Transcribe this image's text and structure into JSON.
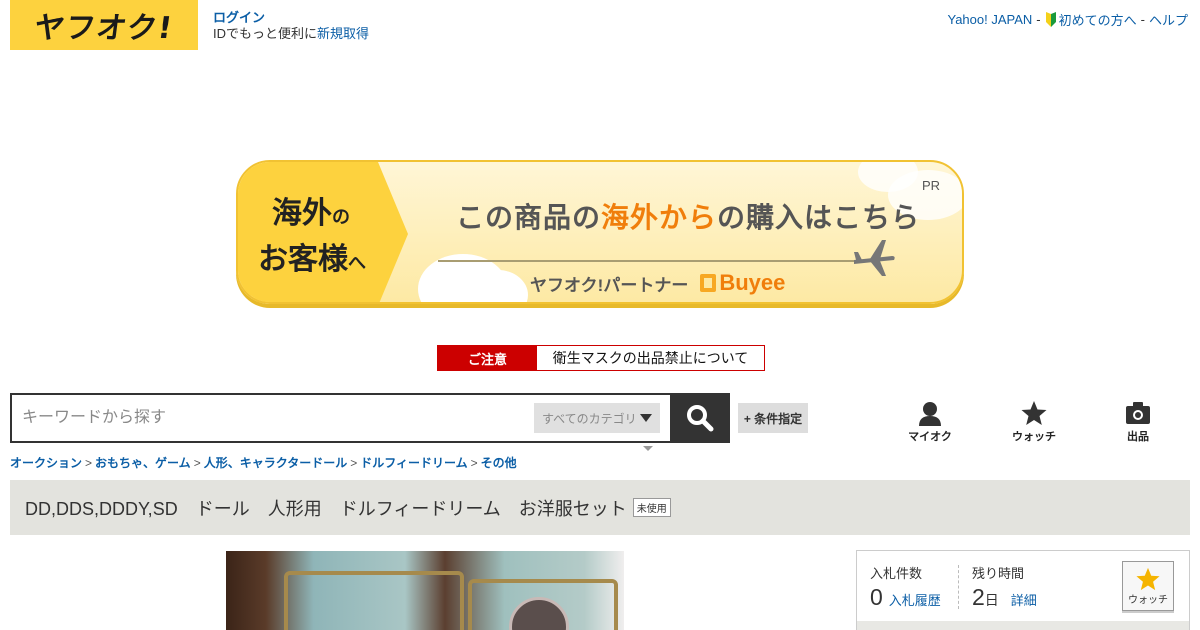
{
  "header": {
    "logo_text": "ヤフオク!",
    "login_label": "ログイン",
    "login_sub": "IDでもっと便利に",
    "register_label": "新規取得",
    "links": [
      "Yahoo! JAPAN",
      "初めての方へ",
      "ヘルプ"
    ],
    "separator": "-"
  },
  "banner": {
    "left_line1": "海外",
    "left_line1_small": "の",
    "left_line2": "お客様",
    "left_line2_small": "へ",
    "main_pre": "この商品の",
    "main_highlight": "海外から",
    "main_post": "の購入はこちら",
    "partner": "ヤフオク!パートナー",
    "buyee": "Buyee",
    "pr": "PR"
  },
  "notice": {
    "tag": "ご注意",
    "text": "衛生マスクの出品禁止について"
  },
  "search": {
    "placeholder": "キーワードから探す",
    "category": "すべてのカテゴリ",
    "condition_button": "+ 条件指定"
  },
  "nav": {
    "myauc": "マイオク",
    "watch": "ウォッチ",
    "sell": "出品"
  },
  "breadcrumb": [
    "オークション",
    "おもちゃ、ゲーム",
    "人形、キャラクタードール",
    "ドルフィードリーム",
    "その他"
  ],
  "breadcrumb_sep": ">",
  "item": {
    "title": "DD,DDS,DDDY,SD　ドール　人形用　ドルフィードリーム　お洋服セット",
    "condition": "未使用"
  },
  "bid": {
    "count_label": "入札件数",
    "count_value": "0",
    "history_link": "入札履歴",
    "time_label": "残り時間",
    "time_value": "2",
    "time_unit": "日",
    "detail_link": "詳細",
    "watch_label": "ウォッチ"
  },
  "colors": {
    "brand_yellow": "#fdd23e",
    "link_blue": "#0b5ea6",
    "notice_red": "#cc0000",
    "highlight_orange": "#f07e0b"
  }
}
